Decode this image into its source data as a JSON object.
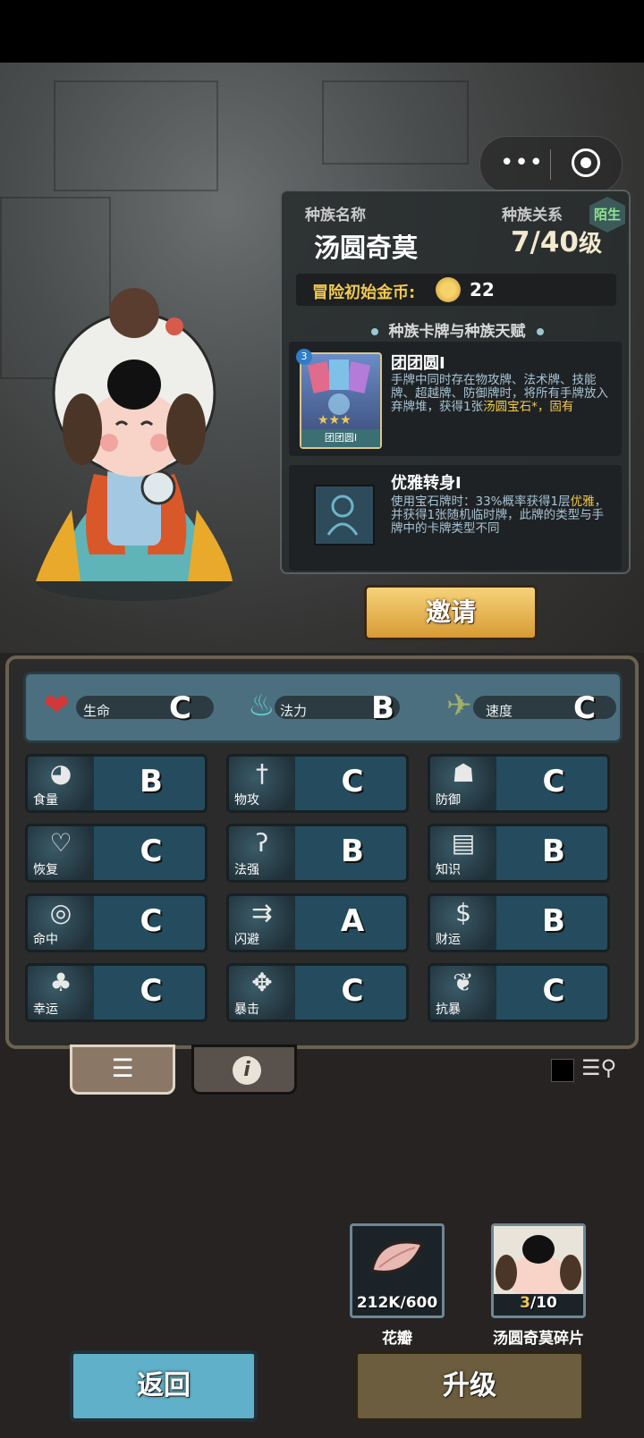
{
  "window": {
    "menu_dots": "•••"
  },
  "race": {
    "name_label": "种族名称",
    "name": "汤圆奇莫",
    "relation_label": "种族关系",
    "relation": "陌生",
    "level": "7/40",
    "level_unit": "级",
    "coins_label": "冒险初始金币:",
    "coins_value": "22"
  },
  "cards": {
    "section_title": "种族卡牌与种族天赋",
    "card": {
      "level_badge": "3",
      "caption": "团团圆I",
      "title": "团团圆I",
      "desc_plain": "手牌中同时存在物攻牌、法术牌、技能牌、超越牌、防御牌时，将所有手牌放入弃牌堆，获得1张",
      "desc_highlight": "汤圆宝石*",
      "desc_tail": "，固有"
    },
    "talent": {
      "title": "优雅转身I",
      "desc_a": "使用宝石牌时：33%概率获得1层",
      "desc_highlight": "优雅",
      "desc_b": "，并获得1张随机临时牌，此牌的类型与手牌中的卡牌类型不同"
    }
  },
  "invite_label": "邀请",
  "core_stats": [
    {
      "name": "生命",
      "grade": "C",
      "icon": "heart-icon"
    },
    {
      "name": "法力",
      "grade": "B",
      "icon": "mana-flame-icon"
    },
    {
      "name": "速度",
      "grade": "C",
      "icon": "winged-boot-icon"
    }
  ],
  "stats": [
    {
      "name": "食量",
      "grade": "B",
      "icon": "stomach-icon"
    },
    {
      "name": "物攻",
      "grade": "C",
      "icon": "sword-icon"
    },
    {
      "name": "防御",
      "grade": "C",
      "icon": "armor-icon"
    },
    {
      "name": "恢复",
      "grade": "C",
      "icon": "heart-plus-icon"
    },
    {
      "name": "法强",
      "grade": "B",
      "icon": "staff-icon"
    },
    {
      "name": "知识",
      "grade": "B",
      "icon": "book-icon"
    },
    {
      "name": "命中",
      "grade": "C",
      "icon": "target-icon"
    },
    {
      "name": "闪避",
      "grade": "A",
      "icon": "dodge-arrows-icon"
    },
    {
      "name": "财运",
      "grade": "B",
      "icon": "coin-icon"
    },
    {
      "name": "幸运",
      "grade": "C",
      "icon": "clover-icon"
    },
    {
      "name": "暴击",
      "grade": "C",
      "icon": "crit-icon"
    },
    {
      "name": "抗暴",
      "grade": "C",
      "icon": "shield-flower-icon"
    }
  ],
  "materials": [
    {
      "label": "花瓣",
      "count_have": "212K",
      "count_need": "/600",
      "icon": "petal-icon"
    },
    {
      "label": "汤圆奇莫碎片",
      "count_have": "3",
      "count_need": "/10",
      "icon": "character-portrait-icon"
    }
  ],
  "buttons": {
    "back": "返回",
    "upgrade": "升级"
  },
  "colors": {
    "accent_gold": "#f2c94c",
    "back_button": "#5fb0c8",
    "upgrade_button": "#6b5d3d",
    "stat_tile": "#244c5e"
  }
}
